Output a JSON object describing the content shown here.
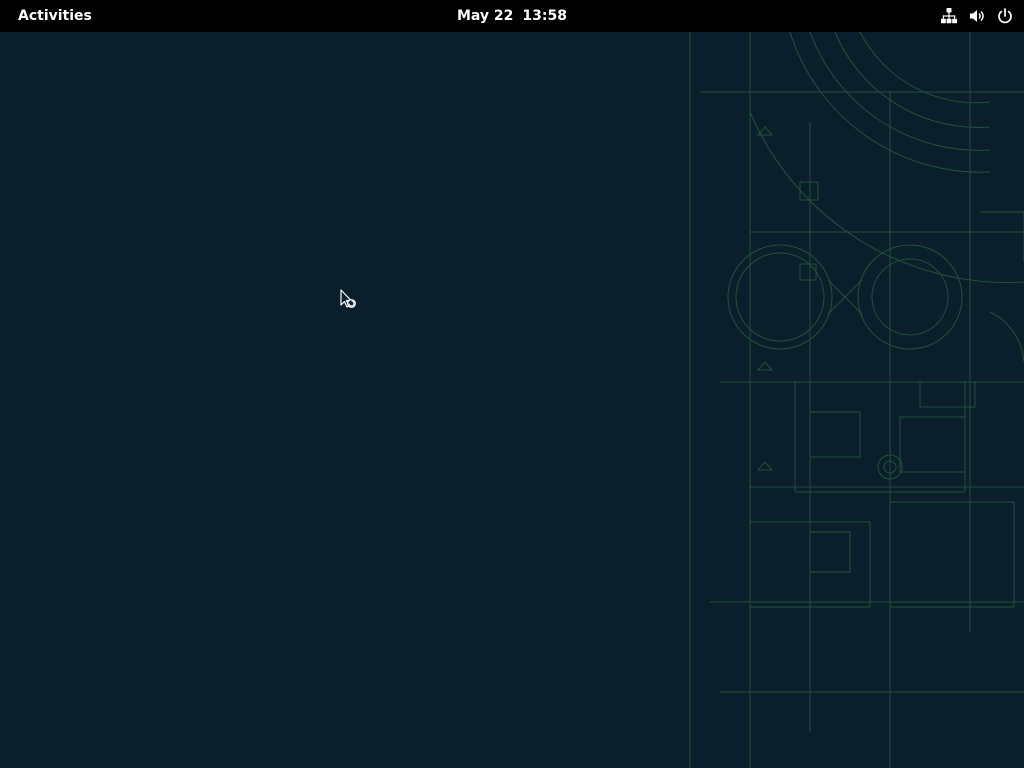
{
  "topbar": {
    "activities_label": "Activities",
    "clock": {
      "date": "May 22",
      "time": "13:58"
    },
    "tray_icons": [
      "network-icon",
      "volume-icon",
      "power-icon"
    ]
  },
  "desktop": {
    "background_color": "#0a1e2b",
    "wallpaper_accent_color": "#3f8a3c"
  },
  "pointer": {
    "state": "busy-arrow"
  }
}
